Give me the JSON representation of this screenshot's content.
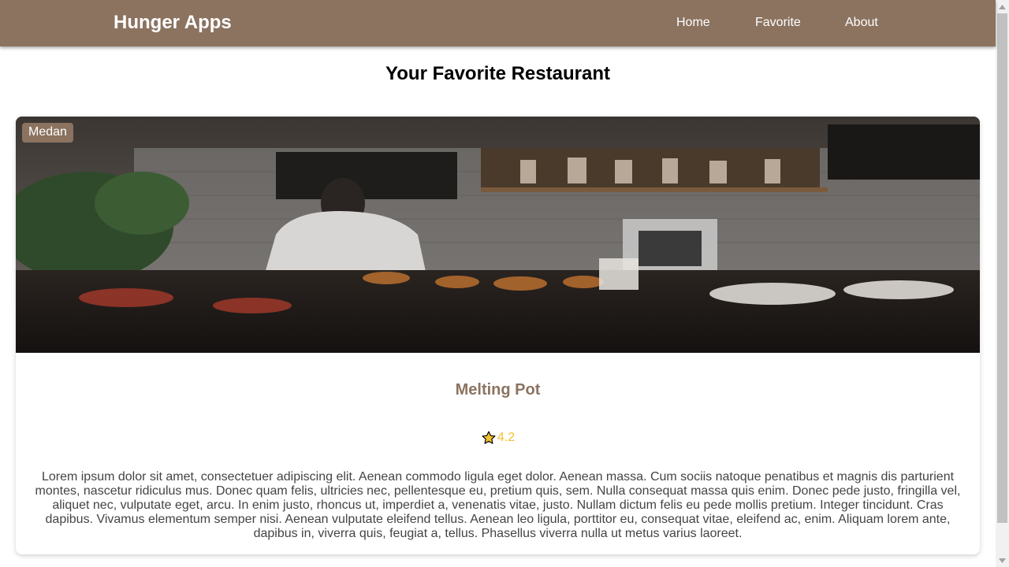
{
  "app": {
    "brand": "Hunger Apps"
  },
  "nav": {
    "items": [
      {
        "label": "Home"
      },
      {
        "label": "Favorite"
      },
      {
        "label": "About"
      }
    ]
  },
  "page": {
    "title": "Your Favorite Restaurant"
  },
  "restaurants": [
    {
      "city": "Medan",
      "name": "Melting Pot",
      "rating": "4.2",
      "description": "Lorem ipsum dolor sit amet, consectetuer adipiscing elit. Aenean commodo ligula eget dolor. Aenean massa. Cum sociis natoque penatibus et magnis dis parturient montes, nascetur ridiculus mus. Donec quam felis, ultricies nec, pellentesque eu, pretium quis, sem. Nulla consequat massa quis enim. Donec pede justo, fringilla vel, aliquet nec, vulputate eget, arcu. In enim justo, rhoncus ut, imperdiet a, venenatis vitae, justo. Nullam dictum felis eu pede mollis pretium. Integer tincidunt. Cras dapibus. Vivamus elementum semper nisi. Aenean vulputate eleifend tellus. Aenean leo ligula, porttitor eu, consequat vitae, eleifend ac, enim. Aliquam lorem ante, dapibus in, viverra quis, feugiat a, tellus. Phasellus viverra nulla ut metus varius laoreet.",
      "image_icon": "restaurant-photo"
    }
  ],
  "colors": {
    "navbar": "#8b7360",
    "accent": "#8b7360",
    "rating": "#f2c230",
    "text": "#444444"
  }
}
